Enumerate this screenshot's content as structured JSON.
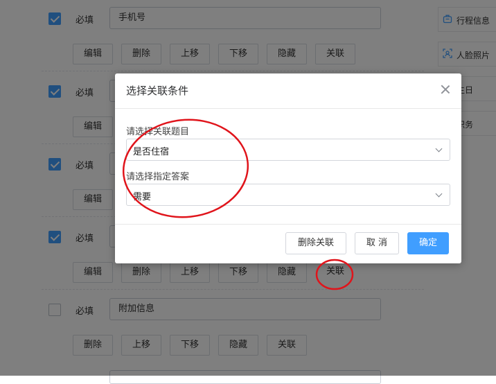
{
  "form": {
    "rows": [
      {
        "required_label": "必填",
        "value": "手机号",
        "placeholder": "",
        "checked": true,
        "actions": [
          "编辑",
          "删除",
          "上移",
          "下移",
          "隐藏",
          "关联"
        ]
      },
      {
        "required_label": "必填",
        "value": "",
        "placeholder": "",
        "checked": true,
        "actions": [
          "编辑"
        ]
      },
      {
        "required_label": "必填",
        "value": "",
        "placeholder": "",
        "checked": true,
        "actions": [
          "编辑"
        ]
      },
      {
        "required_label": "必填",
        "value": "",
        "placeholder": "",
        "checked": true,
        "actions": [
          "编辑",
          "删除",
          "上移",
          "下移",
          "隐藏",
          "关联"
        ]
      },
      {
        "required_label": "必填",
        "value": "附加信息",
        "placeholder": "",
        "checked": false,
        "actions": [
          "删除",
          "上移",
          "下移",
          "隐藏",
          "关联"
        ]
      }
    ]
  },
  "side_panel": {
    "items": [
      {
        "label": "行程信息",
        "icon": "luggage-icon"
      },
      {
        "label": "人脸照片",
        "icon": "face-scan-icon"
      },
      {
        "label": "生日",
        "icon": ""
      },
      {
        "label": "职务",
        "icon": ""
      }
    ]
  },
  "dialog": {
    "title": "选择关联条件",
    "question_label": "请选择关联题目",
    "question_value": "是否住宿",
    "answer_label": "请选择指定答案",
    "answer_value": "需要",
    "delete_button": "删除关联",
    "cancel_button": "取 消",
    "confirm_button": "确定"
  },
  "colors": {
    "primary": "#409eff",
    "annotation": "#e0141b",
    "overlay": "rgba(0,0,0,0.5)"
  }
}
